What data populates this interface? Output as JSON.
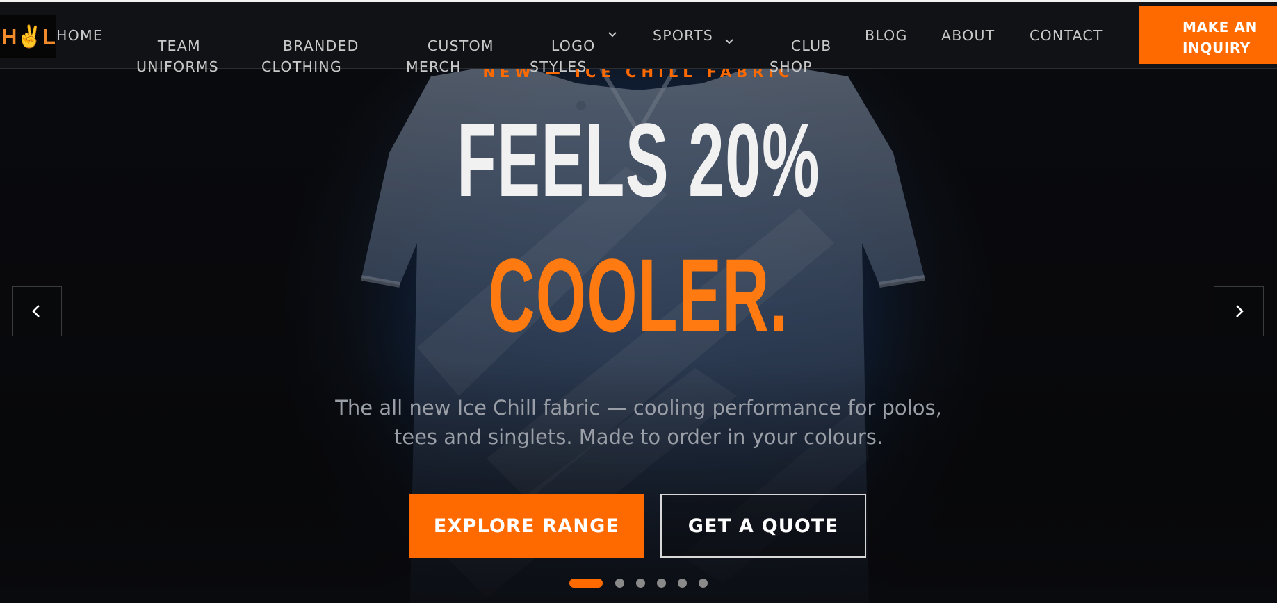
{
  "brand": {
    "logo_text": "H✌L",
    "accent": "#ff6a00"
  },
  "nav": {
    "items": [
      {
        "label": "HOME"
      },
      {
        "label": "TEAM\nUNIFORMS"
      },
      {
        "label": "BRANDED\nCLOTHING"
      },
      {
        "label": "CUSTOM\nMERCH"
      },
      {
        "label": "LOGO\nSTYLES",
        "icon": "chevron-down-icon"
      },
      {
        "label": "SPORTS",
        "icon": "chevron-down-icon"
      },
      {
        "label": "CLUB\nSHOP"
      },
      {
        "label": "BLOG"
      },
      {
        "label": "ABOUT"
      },
      {
        "label": "CONTACT"
      }
    ],
    "cta_line1": "MAKE AN",
    "cta_line2": "INQUIRY"
  },
  "hero": {
    "eyebrow": "NEW — ICE CHILL FABRIC",
    "headline_line1": "FEELS 20%",
    "headline_line2": "COOLER.",
    "subtitle_line1": "The all new Ice Chill fabric — cooling performance for polos,",
    "subtitle_line2": "tees and singlets. Made to order in your colours.",
    "primary_button": "EXPLORE RANGE",
    "secondary_button": "GET A QUOTE",
    "prev_icon": "chevron-left-icon",
    "next_icon": "chevron-right-icon",
    "slides_total": 6,
    "active_slide": 1,
    "colors": {
      "accent": "#ff6a00",
      "headline_white": "#f1f1f1",
      "headline_orange": "#ff7a10"
    }
  }
}
